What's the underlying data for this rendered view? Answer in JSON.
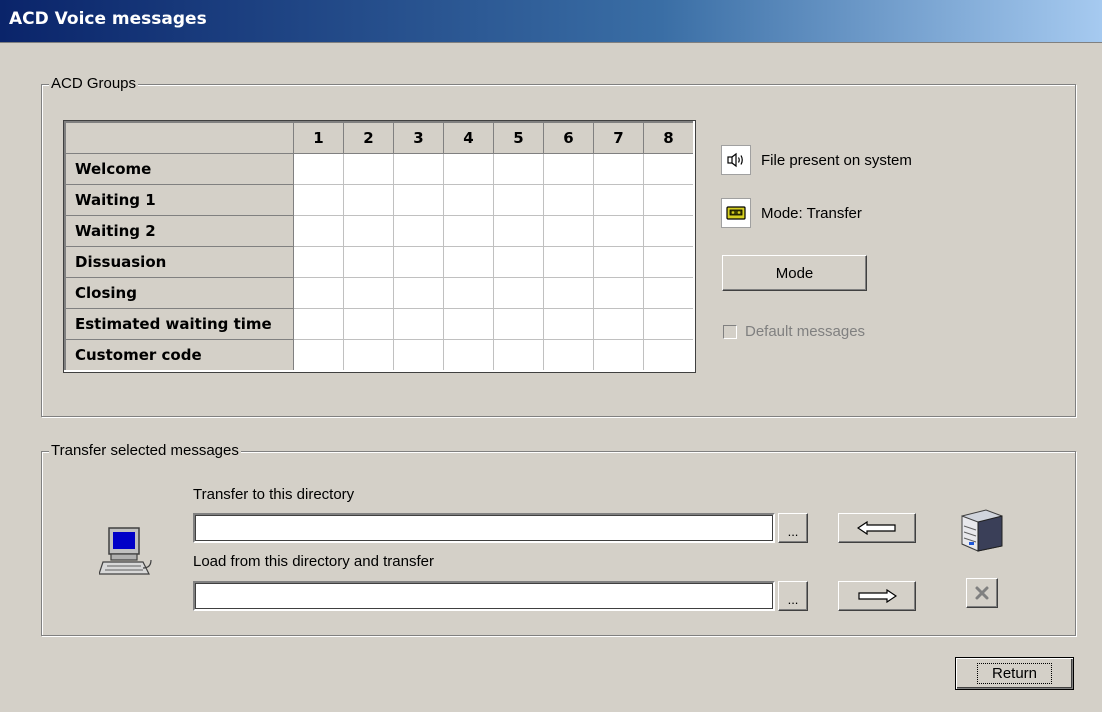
{
  "window": {
    "title": "ACD Voice messages"
  },
  "acd_groups": {
    "legend": "ACD Groups",
    "columns": [
      "1",
      "2",
      "3",
      "4",
      "5",
      "6",
      "7",
      "8"
    ],
    "rows": [
      "Welcome",
      "Waiting 1",
      "Waiting 2",
      "Dissuasion",
      "Closing",
      "Estimated waiting time",
      "Customer code"
    ]
  },
  "status": {
    "file_present_label": "File present on system",
    "file_present_icon": "speaker-icon",
    "mode_label": "Mode: Transfer",
    "mode_icon": "tape-icon"
  },
  "mode_button": "Mode",
  "default_messages": {
    "label": "Default messages",
    "checked": false,
    "enabled": false
  },
  "transfer": {
    "legend": "Transfer selected messages",
    "to_directory_label": "Transfer to this directory",
    "to_directory_value": "",
    "load_directory_label": "Load from this directory and transfer",
    "load_directory_value": "",
    "browse_label": "..."
  },
  "return_button": "Return"
}
